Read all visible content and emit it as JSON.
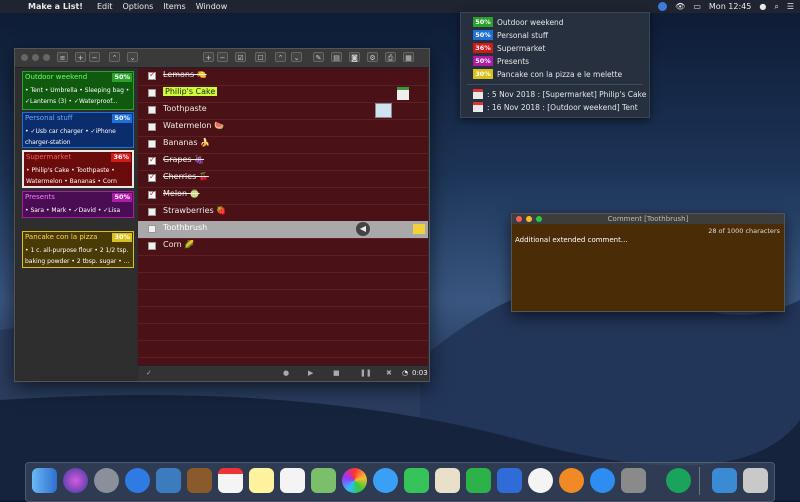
{
  "menubar": {
    "app_name": "Make a List!",
    "items": [
      "Edit",
      "Options",
      "Items",
      "Window"
    ],
    "clock": "Mon 12:45"
  },
  "status_menu": {
    "lists": [
      {
        "percent": "50%",
        "name": "Outdoor weekend",
        "color": "#2aa12a"
      },
      {
        "percent": "50%",
        "name": "Personal stuff",
        "color": "#1f6fd8"
      },
      {
        "percent": "36%",
        "name": "Supermarket",
        "color": "#d11a1a"
      },
      {
        "percent": "50%",
        "name": "Presents",
        "color": "#b01aa8"
      },
      {
        "percent": "30%",
        "name": "Pancake con la pizza e le melette",
        "color": "#d8c11a"
      }
    ],
    "reminders": [
      ": 5 Nov 2018 : [Supermarket] Philip's Cake",
      ": 16 Nov 2018 : [Outdoor weekend] Tent"
    ]
  },
  "sidebar": {
    "cards": [
      {
        "title": "Outdoor weekend",
        "percent": "50%",
        "body": "• Tent • Umbrella • Sleeping bag • ✓Lanterns (3) • ✓Waterproof...",
        "bg": "#0f5a0f",
        "title_color": "#6cff6c",
        "badge": "#2aa12a"
      },
      {
        "title": "Personal stuff",
        "percent": "50%",
        "body": "• ✓Usb car charger • ✓iPhone charger-station",
        "bg": "#0c2d6b",
        "title_color": "#6aa8ff",
        "badge": "#1f6fd8"
      },
      {
        "title": "Supermarket",
        "percent": "36%",
        "body": "• Philip's Cake • Toothpaste • Watermelon • Bananas • Corn",
        "bg": "#6b0c0c",
        "title_color": "#ff5a5a",
        "badge": "#d11a1a"
      },
      {
        "title": "Presents",
        "percent": "50%",
        "body": "• Sara • Mark • ✓David • ✓Lisa",
        "bg": "#4a0c52",
        "title_color": "#ff7aff",
        "badge": "#b01aa8"
      },
      {
        "title": "Pancake con la pizza",
        "percent": "30%",
        "body": "• 1 c. all-purpose flour • 2 1/2 tsp. baking powder • 2 tbsp. sugar • ...",
        "bg": "#4a3a06",
        "title_color": "#ffd84a",
        "badge": "#d8c11a"
      }
    ]
  },
  "list": {
    "items": [
      {
        "label": "Lemons 🍋",
        "checked": true
      },
      {
        "label": "Philip's Cake",
        "checked": false
      },
      {
        "label": "Toothpaste",
        "checked": false
      },
      {
        "label": "Watermelon 🍉",
        "checked": false
      },
      {
        "label": "Bananas 🍌",
        "checked": false
      },
      {
        "label": "Grapes 🍇",
        "checked": true
      },
      {
        "label": "Cherries 🍒",
        "checked": true
      },
      {
        "label": "Melon 🍈",
        "checked": true
      },
      {
        "label": "Strawberries 🍓",
        "checked": false
      },
      {
        "label": "Toothbrush",
        "checked": false
      },
      {
        "label": "Corn 🌽",
        "checked": false
      }
    ],
    "timer": "0:03"
  },
  "comment_window": {
    "title": "Comment [Toothbrush]",
    "char_count": "28 of 1000 characters",
    "text": "Additional extended comment..."
  },
  "colors": {
    "list_bg": "#4a1216",
    "comment_bg": "#4a2c06",
    "menubar": "#1f2530"
  }
}
